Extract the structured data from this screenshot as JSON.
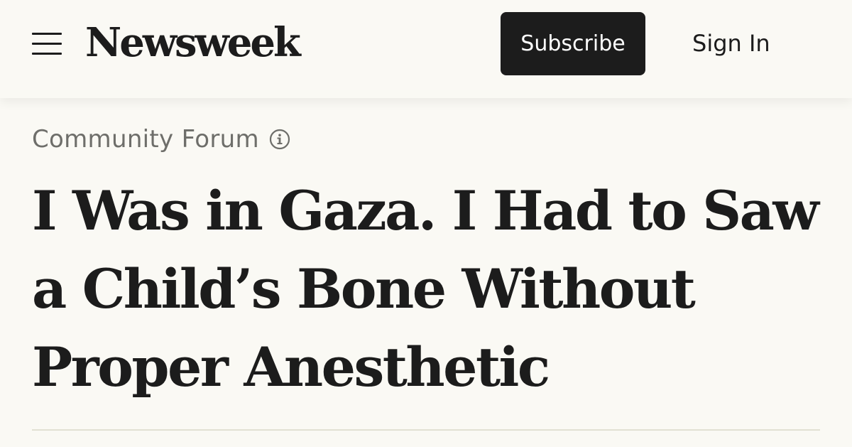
{
  "header": {
    "menu_icon": "hamburger-menu-icon",
    "logo_text": "Newsweek",
    "subscribe_label": "Subscribe",
    "signin_label": "Sign In"
  },
  "article": {
    "section_label": "Community Forum",
    "section_info_icon": "info-icon",
    "headline": "I Was in Gaza. I Had to Saw a Child’s Bone Without Proper Anesthetic"
  },
  "colors": {
    "background": "#faf9f4",
    "text": "#1c1c1c",
    "button_bg": "#1c1c1c",
    "button_text": "#ffffff",
    "section_label": "#6e6e6a",
    "divider": "#e2e0d3"
  }
}
